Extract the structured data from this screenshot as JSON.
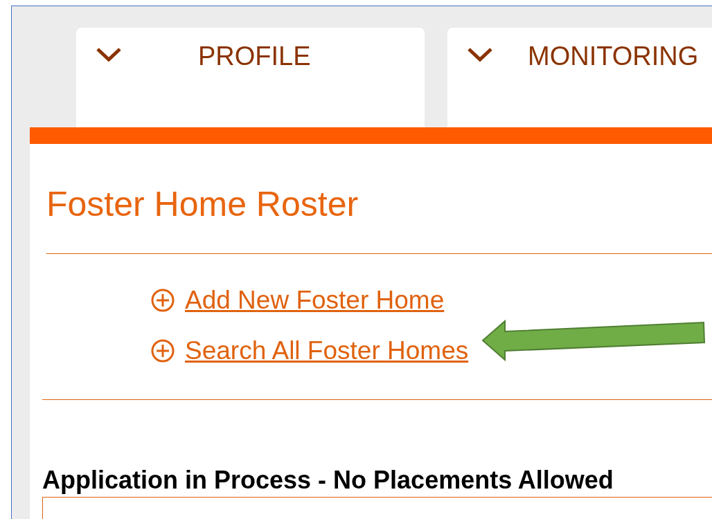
{
  "tabs": [
    {
      "label": "PROFILE"
    },
    {
      "label": "MONITORING"
    }
  ],
  "section": {
    "title": "Foster Home Roster",
    "links": [
      {
        "label": "Add New Foster Home",
        "highlighted": false
      },
      {
        "label": "Search All Foster Homes",
        "highlighted": true
      }
    ]
  },
  "status": {
    "heading": "Application in Process - No Placements Allowed"
  }
}
